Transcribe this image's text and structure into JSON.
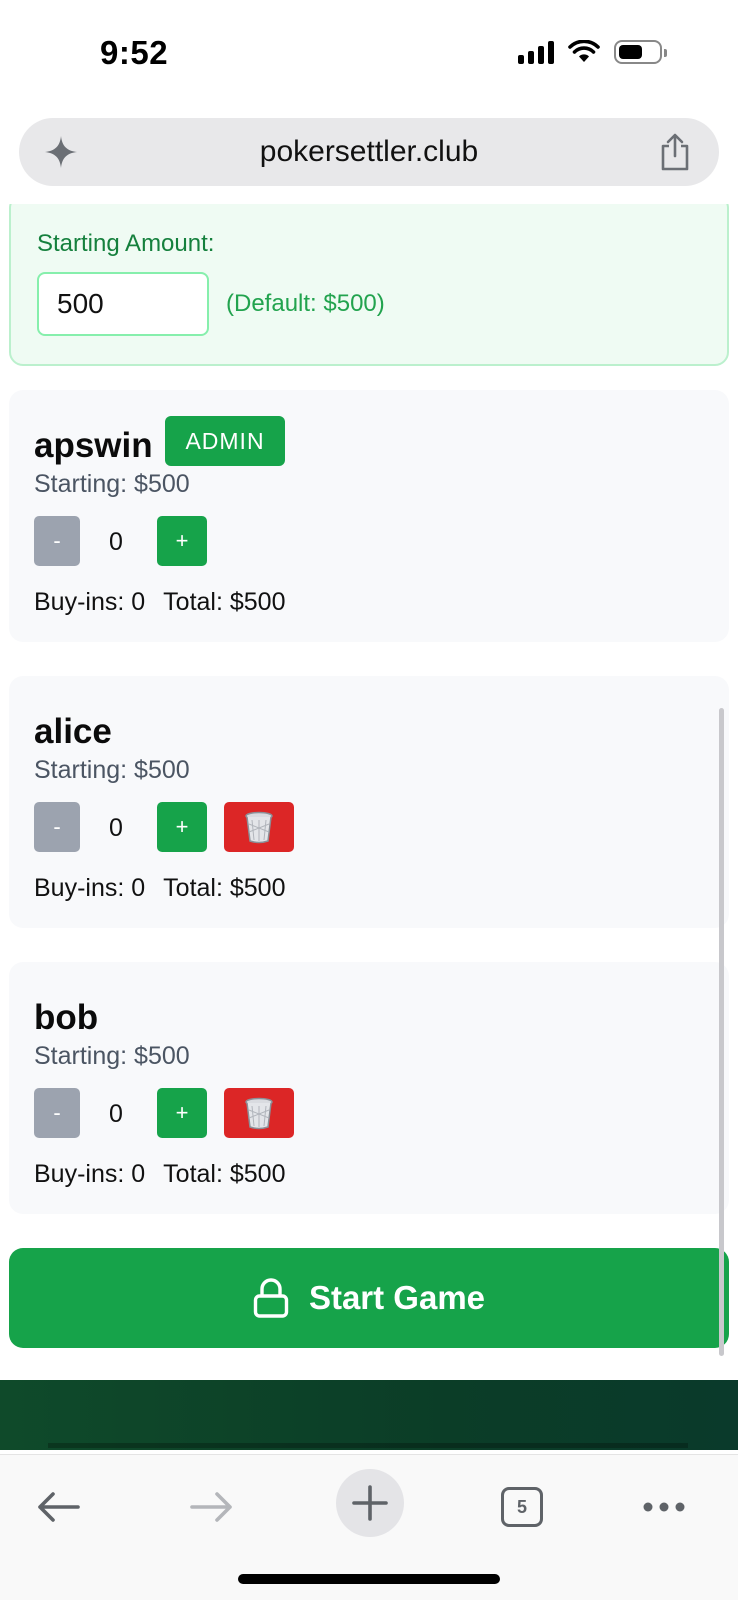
{
  "status_bar": {
    "time": "9:52"
  },
  "browser": {
    "url": "pokersettler.club",
    "open_tabs": "5"
  },
  "starting_amount": {
    "label": "Starting Amount:",
    "value": "500",
    "hint": "(Default: $500)"
  },
  "players": [
    {
      "name": "apswin",
      "badge": "ADMIN",
      "starting": "Starting: $500",
      "minus": "-",
      "count": "0",
      "plus": "+",
      "buyins": "Buy-ins: 0",
      "total": "Total: $500"
    },
    {
      "name": "alice",
      "starting": "Starting: $500",
      "minus": "-",
      "count": "0",
      "plus": "+",
      "buyins": "Buy-ins: 0",
      "total": "Total: $500"
    },
    {
      "name": "bob",
      "starting": "Starting: $500",
      "minus": "-",
      "count": "0",
      "plus": "+",
      "buyins": "Buy-ins: 0",
      "total": "Total: $500"
    }
  ],
  "start_game": {
    "label": "Start Game"
  },
  "icons": {
    "url_left": "sparkle-icon",
    "url_right": "share-icon",
    "delete": "trash-icon",
    "start": "lock-icon",
    "back": "back-arrow-icon",
    "forward": "forward-arrow-icon",
    "new_tab": "plus-icon",
    "more": "more-icon"
  },
  "colors": {
    "accent_green": "#16a34a",
    "delete_red": "#dc2626",
    "minus_gray": "#9ca3af",
    "highlight_bg": "#effbf3"
  }
}
